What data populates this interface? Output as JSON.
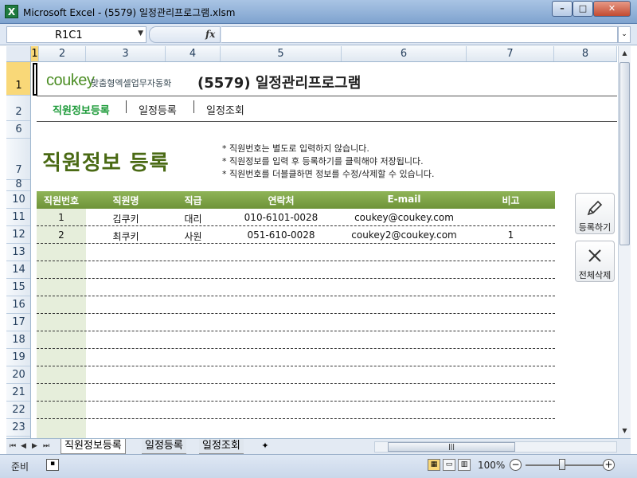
{
  "window": {
    "title": "Microsoft Excel - (5579) 일정관리프로그램.xlsm",
    "app_icon": "X",
    "minimize_label": "–",
    "maximize_label": "□",
    "close_label": "✕"
  },
  "formula_bar": {
    "name_box": "R1C1",
    "name_box_arrow": "▼",
    "fx_label": "fx",
    "formula_value": "",
    "expand_label": "⌄"
  },
  "columns": [
    "1",
    "2",
    "3",
    "4",
    "5",
    "6",
    "7",
    "8"
  ],
  "rows": [
    "1",
    "2",
    "6",
    "7",
    "8",
    "10",
    "11",
    "12",
    "13",
    "14",
    "15",
    "16",
    "17",
    "18",
    "19",
    "20",
    "21",
    "22",
    "23"
  ],
  "header": {
    "logo": "coukey",
    "logo_sub": "맞춤형엑셀업무자동화",
    "program_title": "(5579) 일정관리프로그램"
  },
  "nav": {
    "employee_register": "직원정보등록",
    "schedule_register": "일정등록",
    "schedule_view": "일정조회",
    "separator": "|"
  },
  "section": {
    "title": "직원정보 등록",
    "notes": [
      "* 직원번호는 별도로 입력하지 않습니다.",
      "* 직원정보를 입력 후 등록하기를 클릭해야 저장됩니다.",
      "* 직원번호를 더블클하면 정보를 수정/삭제할 수 있습니다."
    ]
  },
  "table": {
    "headers": [
      "직원번호",
      "직원명",
      "직급",
      "연락처",
      "E-mail",
      "비고"
    ],
    "rows": [
      [
        "1",
        "김쿠키",
        "대리",
        "010-6101-0028",
        "coukey@coukey.com",
        ""
      ],
      [
        "2",
        "최쿠키",
        "사원",
        "051-610-0028",
        "coukey2@coukey.com",
        "1"
      ]
    ],
    "empty_rows": 11
  },
  "side_buttons": {
    "register": {
      "label": "등록하기",
      "icon": "pencil-icon"
    },
    "delete_all": {
      "label": "전체삭제",
      "icon": "x-icon"
    }
  },
  "sheet_tabs": {
    "nav_first": "⏮",
    "nav_prev": "◀",
    "nav_next": "▶",
    "nav_last": "⏭",
    "tabs": [
      "직원정보등록",
      "일정등록",
      "일정조회"
    ],
    "new_sheet": "✦"
  },
  "status_bar": {
    "status": "준비",
    "zoom": "100%",
    "zoom_minus": "−",
    "zoom_plus": "+"
  },
  "colors": {
    "accent_green": "#1e9b3a",
    "title_green": "#4a6a14",
    "table_header": "#7ea348",
    "id_column_fill": "#e6eedb"
  }
}
